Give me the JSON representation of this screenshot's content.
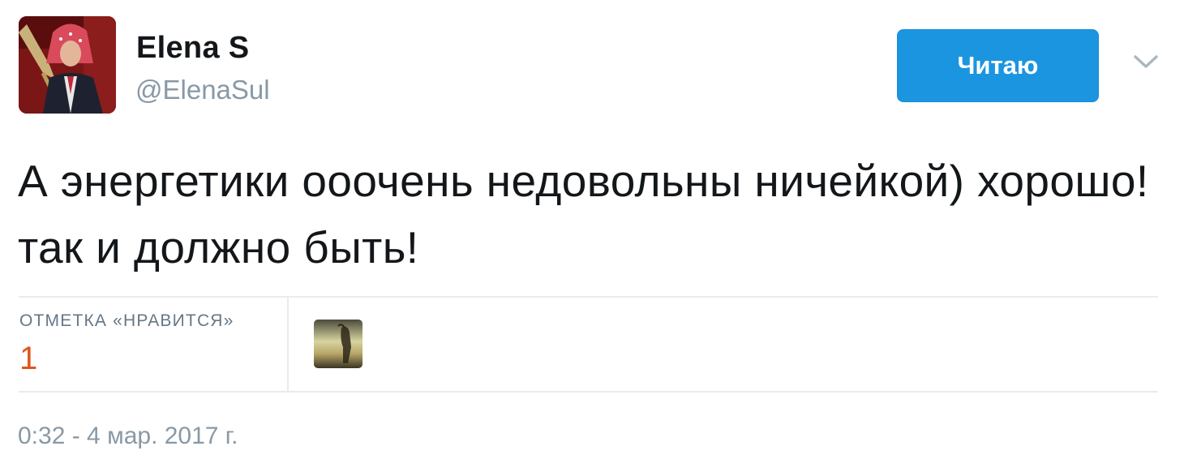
{
  "user": {
    "name": "Elena S",
    "screen_name": "@ElenaSul",
    "avatar": "profile-photo"
  },
  "follow_button": {
    "label": "Читаю",
    "color": "#1b95e0"
  },
  "menu": {
    "icon": "chevron-down-icon"
  },
  "tweet": {
    "text": "А энергетики ооочень недовольны ничейкой) хорошо! так и должно быть!"
  },
  "stats": {
    "likes_label": "ОТМЕТКА «НРАВИТСЯ»",
    "likes_count": "1",
    "likes_color": "#e0531d"
  },
  "timestamp": "0:32 - 4 мар. 2017 г."
}
